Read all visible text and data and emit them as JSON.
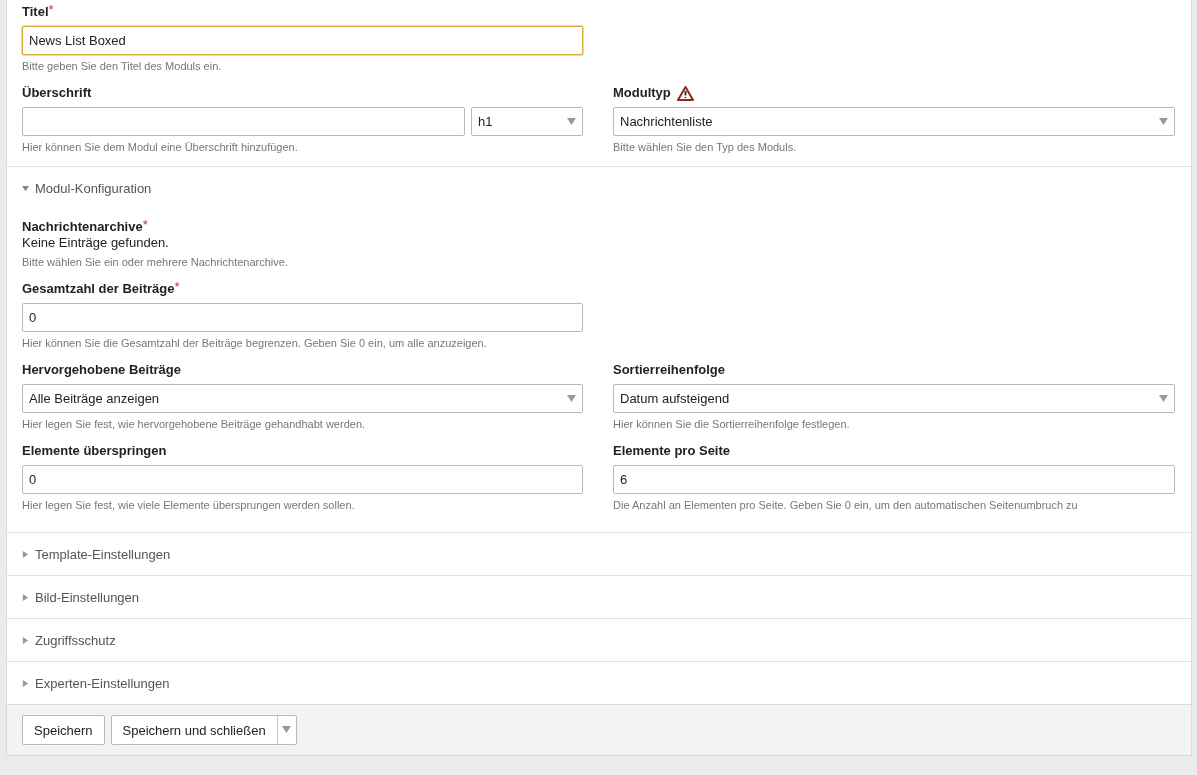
{
  "title_field": {
    "label": "Titel",
    "required_mark": "*",
    "value": "News List Boxed",
    "focused": true,
    "help": "Bitte geben Sie den Titel des Moduls ein."
  },
  "heading": {
    "label": "Überschrift",
    "level": "h1",
    "help": "Hier können Sie dem Modul eine Überschrift hinzufügen."
  },
  "module_type": {
    "label": "Modultyp",
    "warning": true,
    "value": "Nachrichtenliste",
    "help": "Bitte wählen Sie den Typ des Moduls."
  },
  "sections": [
    {
      "title": "Modul-Konfiguration",
      "expanded": true,
      "rows": [
        [
          {
            "kind": "static",
            "label": "Nachrichtenarchive",
            "required_mark": "*",
            "value": "Keine Einträge gefunden.",
            "help": "Bitte wählen Sie ein oder mehrere Nachrichtenarchive."
          }
        ],
        [
          {
            "kind": "input",
            "label": "Gesamtzahl der Beiträge",
            "required_mark": "*",
            "value": "0",
            "help": "Hier können Sie die Gesamtzahl der Beiträge begrenzen. Geben Sie 0 ein, um alle anzuzeigen."
          }
        ],
        [
          {
            "kind": "select",
            "label": "Hervorgehobene Beiträge",
            "value": "Alle Beiträge anzeigen",
            "help": "Hier legen Sie fest, wie hervorgehobene Beiträge gehandhabt werden."
          },
          {
            "kind": "select",
            "label": "Sortierreihenfolge",
            "value": "Datum aufsteigend",
            "help": "Hier können Sie die Sortierreihenfolge festlegen."
          }
        ],
        [
          {
            "kind": "input",
            "label": "Elemente überspringen",
            "value": "0",
            "help": "Hier legen Sie fest, wie viele Elemente übersprungen werden sollen."
          },
          {
            "kind": "input",
            "label": "Elemente pro Seite",
            "value": "6",
            "help": "Die Anzahl an Elementen pro Seite. Geben Sie 0 ein, um den automatischen Seitenumbruch zu"
          }
        ]
      ]
    },
    {
      "title": "Template-Einstellungen",
      "expanded": false
    },
    {
      "title": "Bild-Einstellungen",
      "expanded": false
    },
    {
      "title": "Zugriffsschutz",
      "expanded": false
    },
    {
      "title": "Experten-Einstellungen",
      "expanded": false
    }
  ],
  "buttons": {
    "save": "Speichern",
    "save_close": "Speichern und schließen"
  }
}
